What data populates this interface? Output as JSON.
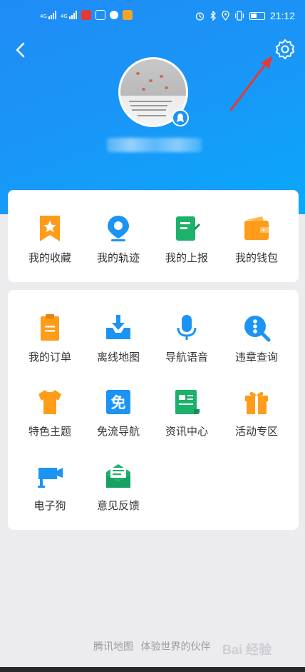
{
  "statusbar": {
    "network1": "4G",
    "network2": "4G",
    "time": "21:12"
  },
  "header": {
    "back_icon": "chevron-left-icon",
    "settings_icon": "gear-icon"
  },
  "profile": {
    "avatar_badge_icon": "qq-penguin-icon"
  },
  "quick_menu": [
    {
      "label": "我的收藏",
      "icon": "bookmark-star-icon",
      "color": "#ff9c1a"
    },
    {
      "label": "我的轨迹",
      "icon": "location-pin-icon",
      "color": "#1c94f4"
    },
    {
      "label": "我的上报",
      "icon": "report-doc-icon",
      "color": "#1cb26b"
    },
    {
      "label": "我的钱包",
      "icon": "wallet-icon",
      "color": "#ff9c1a"
    }
  ],
  "services": [
    {
      "label": "我的订单",
      "icon": "order-clipboard-icon",
      "color": "#ff9c1a"
    },
    {
      "label": "离线地图",
      "icon": "download-tray-icon",
      "color": "#1c94f4"
    },
    {
      "label": "导航语音",
      "icon": "microphone-icon",
      "color": "#1c94f4"
    },
    {
      "label": "违章查询",
      "icon": "search-dots-icon",
      "color": "#1c94f4"
    },
    {
      "label": "特色主题",
      "icon": "tshirt-icon",
      "color": "#ff9c1a"
    },
    {
      "label": "免流导航",
      "icon": "free-data-icon",
      "color": "#1c94f4",
      "glyph": "免"
    },
    {
      "label": "资讯中心",
      "icon": "news-scroll-icon",
      "color": "#1cb26b"
    },
    {
      "label": "活动专区",
      "icon": "gift-icon",
      "color": "#ff9c1a"
    },
    {
      "label": "电子狗",
      "icon": "camera-dog-icon",
      "color": "#1c94f4"
    },
    {
      "label": "意见反馈",
      "icon": "feedback-envelope-icon",
      "color": "#1cb26b"
    }
  ],
  "footer": {
    "brand": "腾讯地图",
    "slogan": "体验世界的伙伴"
  },
  "watermark": "Bai 经验"
}
